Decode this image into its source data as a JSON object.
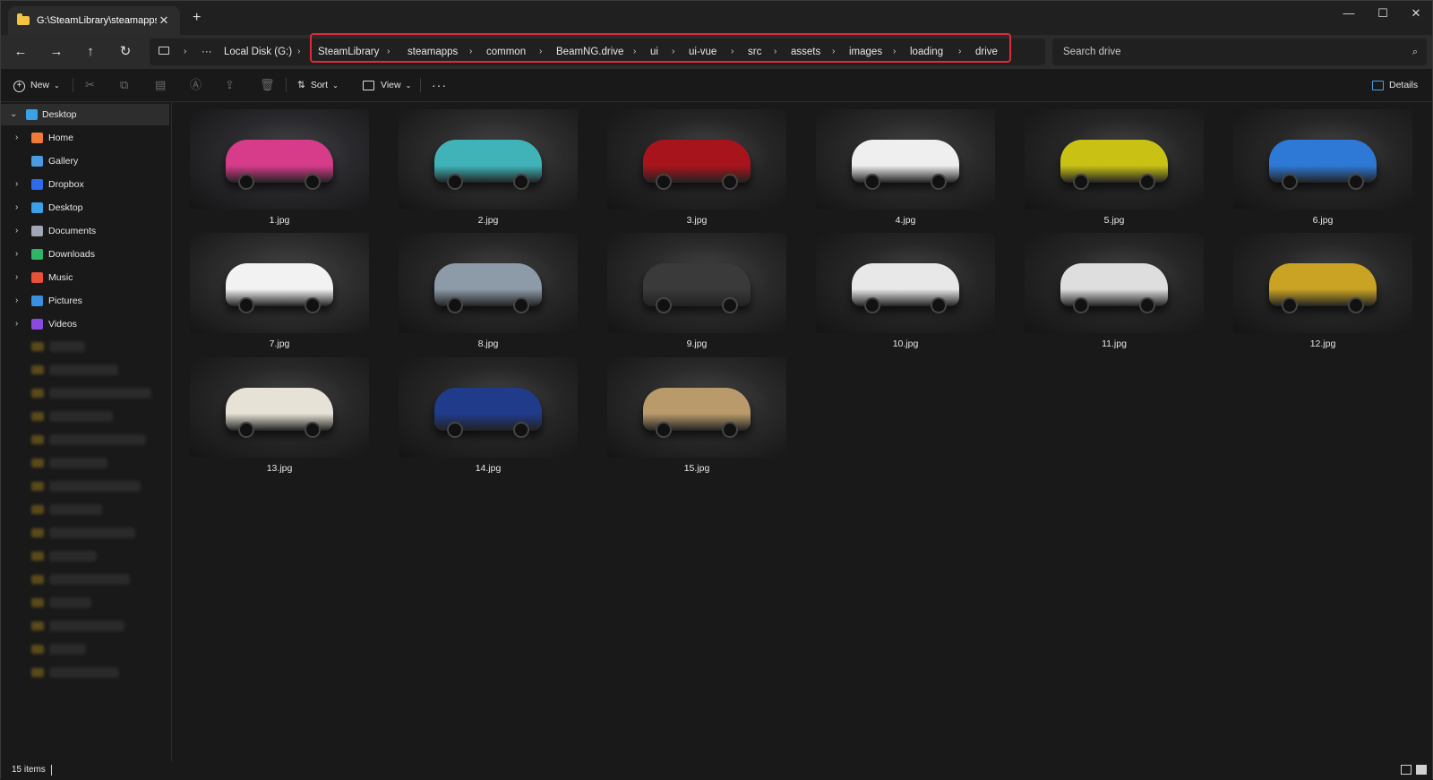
{
  "window": {
    "tab_title": "G:\\SteamLibrary\\steamapps\\c",
    "tab_close": "✕",
    "tab_add": "+",
    "minimize": "—",
    "maximize": "☐",
    "close": "✕"
  },
  "nav": {
    "back": "←",
    "forward": "→",
    "up": "↑",
    "refresh": "↻",
    "computer_chevron": "›",
    "more": "···"
  },
  "breadcrumb": [
    "Local Disk (G:)",
    "SteamLibrary",
    "steamapps",
    "common",
    "BeamNG.drive",
    "ui",
    "ui-vue",
    "src",
    "assets",
    "images",
    "loading",
    "drive"
  ],
  "search": {
    "placeholder": "Search drive"
  },
  "toolbar": {
    "new_label": "New",
    "sort_label": "Sort",
    "view_label": "View",
    "more_label": "···",
    "details_label": "Details"
  },
  "sidebar": {
    "items": [
      {
        "label": "Desktop",
        "icon": "desktop-icon",
        "color": "#3aa0e8"
      },
      {
        "label": "Home",
        "icon": "home-icon",
        "color": "#f07a3a"
      },
      {
        "label": "Gallery",
        "icon": "gallery-icon",
        "color": "#4a9be0"
      },
      {
        "label": "Dropbox",
        "icon": "dropbox-icon",
        "color": "#2f6be8"
      },
      {
        "label": "Desktop",
        "icon": "desktop-icon",
        "color": "#3aa0e8"
      },
      {
        "label": "Documents",
        "icon": "documents-icon",
        "color": "#a0a8b8"
      },
      {
        "label": "Downloads",
        "icon": "downloads-icon",
        "color": "#2fb56a"
      },
      {
        "label": "Music",
        "icon": "music-icon",
        "color": "#e8503a"
      },
      {
        "label": "Pictures",
        "icon": "pictures-icon",
        "color": "#3a8fe0"
      },
      {
        "label": "Videos",
        "icon": "videos-icon",
        "color": "#8a4ae0"
      }
    ]
  },
  "files": [
    {
      "name": "1.jpg",
      "color": "#d63c8a",
      "bg": "#2a2a2e"
    },
    {
      "name": "2.jpg",
      "color": "#3fb3b8",
      "bg": "#2c2c2c"
    },
    {
      "name": "3.jpg",
      "color": "#a8141c",
      "bg": "#262626"
    },
    {
      "name": "4.jpg",
      "color": "#efefef",
      "bg": "#2a2a2a"
    },
    {
      "name": "5.jpg",
      "color": "#c9c215",
      "bg": "#262626"
    },
    {
      "name": "6.jpg",
      "color": "#2f79d6",
      "bg": "#262626"
    },
    {
      "name": "7.jpg",
      "color": "#f2f2f2",
      "bg": "#2e2e2e"
    },
    {
      "name": "8.jpg",
      "color": "#8d9aa8",
      "bg": "#282828"
    },
    {
      "name": "9.jpg",
      "color": "#3a3a3a",
      "bg": "#2a2a2a"
    },
    {
      "name": "10.jpg",
      "color": "#e8e8e8",
      "bg": "#262626"
    },
    {
      "name": "11.jpg",
      "color": "#dedede",
      "bg": "#262626"
    },
    {
      "name": "12.jpg",
      "color": "#caa325",
      "bg": "#262626"
    },
    {
      "name": "13.jpg",
      "color": "#e6e2d6",
      "bg": "#282828"
    },
    {
      "name": "14.jpg",
      "color": "#1f3b8a",
      "bg": "#262626"
    },
    {
      "name": "15.jpg",
      "color": "#b99a6a",
      "bg": "#2a2a2a"
    }
  ],
  "status": {
    "count": "15 items"
  },
  "accent": "#e02a3a"
}
